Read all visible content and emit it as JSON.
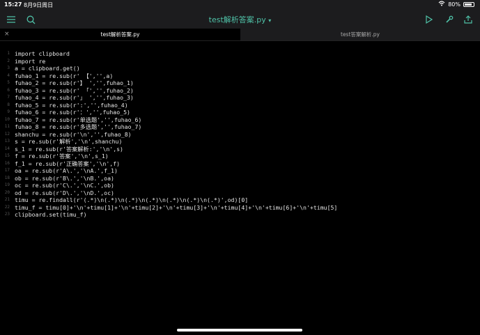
{
  "status": {
    "time": "15:27",
    "date": "8月9日周日",
    "battery": "80%",
    "battery_level": 0.8
  },
  "toolbar": {
    "title": "test解析答案.py",
    "title_chevron": "▾"
  },
  "tabs": [
    {
      "label": "test解析答案.py",
      "close": "×"
    },
    {
      "label": "test答案解析.py"
    }
  ],
  "code_lines": [
    {
      "n": "1",
      "t": "import clipboard"
    },
    {
      "n": "2",
      "t": "import re"
    },
    {
      "n": "3",
      "t": "a = clipboard.get()"
    },
    {
      "n": "4",
      "t": "fuhao_1 = re.sub(r' 【','',a)"
    },
    {
      "n": "5",
      "t": "fuhao_2 = re.sub(r'】 ','',fuhao_1)"
    },
    {
      "n": "6",
      "t": "fuhao_3 = re.sub(r' 「','',fuhao_2)"
    },
    {
      "n": "7",
      "t": "fuhao_4 = re.sub(r'」 ','',fuhao_3)"
    },
    {
      "n": "8",
      "t": "fuhao_5 = re.sub(r':','',fuhao_4)"
    },
    {
      "n": "9",
      "t": "fuhao_6 = re.sub(r'：','',fuhao_5)"
    },
    {
      "n": "10",
      "t": "fuhao_7 = re.sub(r'单选题','',fuhao_6)"
    },
    {
      "n": "11",
      "t": "fuhao_8 = re.sub(r'多选题','',fuhao_7)"
    },
    {
      "n": "12",
      "t": "shanchu = re.sub(r'\\n','',fuhao_8)"
    },
    {
      "n": "13",
      "t": "s = re.sub(r'解析','\\n',shanchu)"
    },
    {
      "n": "14",
      "t": "s_1 = re.sub(r'答案解析:','\\n',s)"
    },
    {
      "n": "15",
      "t": "f = re.sub(r'答案','\\n',s_1)"
    },
    {
      "n": "16",
      "t": "f_1 = re.sub(r'正确答案','\\n',f)"
    },
    {
      "n": "17",
      "t": "oa = re.sub(r'A\\.','\\nA.',f_1)"
    },
    {
      "n": "18",
      "t": "ob = re.sub(r'B\\.','\\nB.',oa)"
    },
    {
      "n": "19",
      "t": "oc = re.sub(r'C\\.','\\nC.',ob)"
    },
    {
      "n": "20",
      "t": "od = re.sub(r'D\\.','\\nD.',oc)"
    },
    {
      "n": "21",
      "t": "timu = re.findall(r'(.*)\\n(.*)\\n(.*)\\n(.*)\\n(.*)\\n(.*)\\n(.*)',od)[0]"
    },
    {
      "n": "22",
      "t": "timu_f = timu[0]+'\\n'+timu[1]+'\\n'+timu[2]+'\\n'+timu[3]+'\\n'+timu[4]+'\\n'+timu[6]+'\\n'+timu[5]"
    },
    {
      "n": "23",
      "t": "clipboard.set(timu_f)"
    }
  ]
}
